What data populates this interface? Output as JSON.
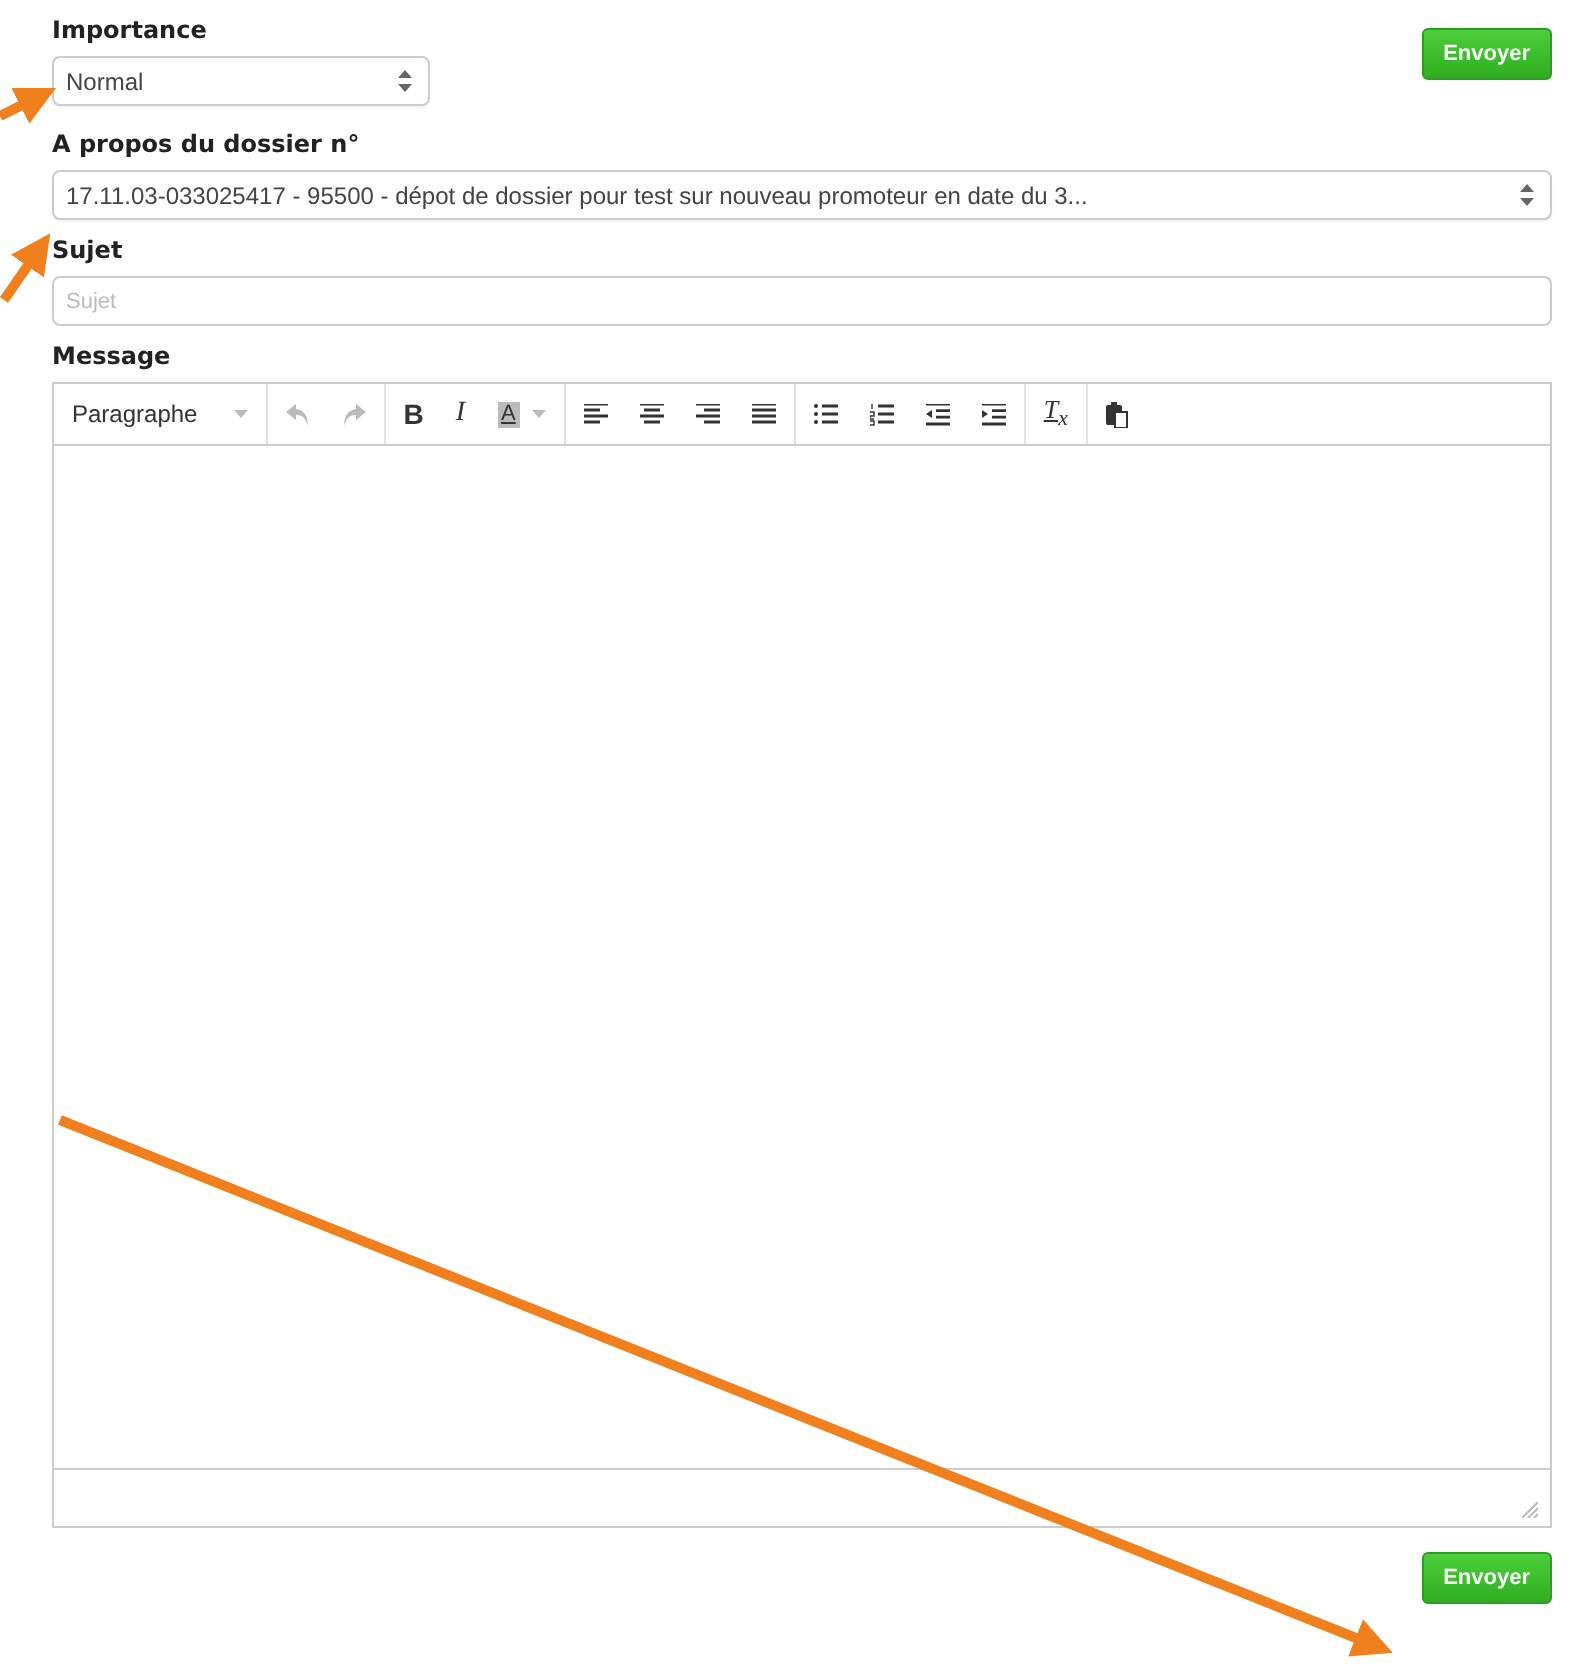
{
  "importance": {
    "label": "Importance",
    "value": "Normal"
  },
  "send_top": "Envoyer",
  "dossier": {
    "label": "A propos du dossier n°",
    "value": "17.11.03-033025417 - 95500 - dépot de dossier pour test sur nouveau promoteur en date du 3..."
  },
  "subject": {
    "label": "Sujet",
    "placeholder": "Sujet"
  },
  "message": {
    "label": "Message",
    "toolbar": {
      "format": "Paragraphe",
      "undo_disabled": true,
      "redo_disabled": true,
      "bold": "B",
      "italic": "I",
      "text_color": "A",
      "clear_format": "T$_{x}$"
    }
  },
  "send_bottom": "Envoyer"
}
